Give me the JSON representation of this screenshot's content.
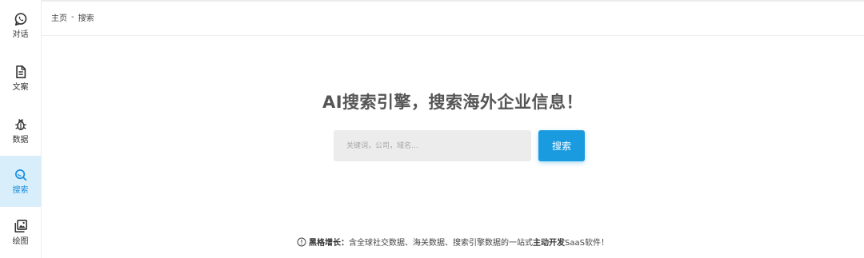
{
  "sidebar": {
    "items": [
      {
        "label": "对话",
        "icon": "chat-bubble-icon",
        "active": false
      },
      {
        "label": "文案",
        "icon": "document-icon",
        "active": false
      },
      {
        "label": "数据",
        "icon": "bug-icon",
        "active": false
      },
      {
        "label": "搜索",
        "icon": "search-icon",
        "active": true
      },
      {
        "label": "绘图",
        "icon": "image-gallery-icon",
        "active": false
      }
    ]
  },
  "breadcrumb": {
    "home": "主页",
    "separator": "-",
    "current": "搜索"
  },
  "main": {
    "headline": "AI搜索引擎，搜索海外企业信息！"
  },
  "search": {
    "placeholder": "关键词，公司，域名...",
    "value": "",
    "button_label": "搜索"
  },
  "footer": {
    "brand": "黑格增长：",
    "text_before": "含全球社交数据、海关数据、搜索引擎数据的一站式",
    "highlight": "主动开发",
    "text_after": "SaaS软件！"
  },
  "colors": {
    "accent": "#1a9be0",
    "active_bg": "#d9eefb",
    "input_bg": "#ececec"
  }
}
